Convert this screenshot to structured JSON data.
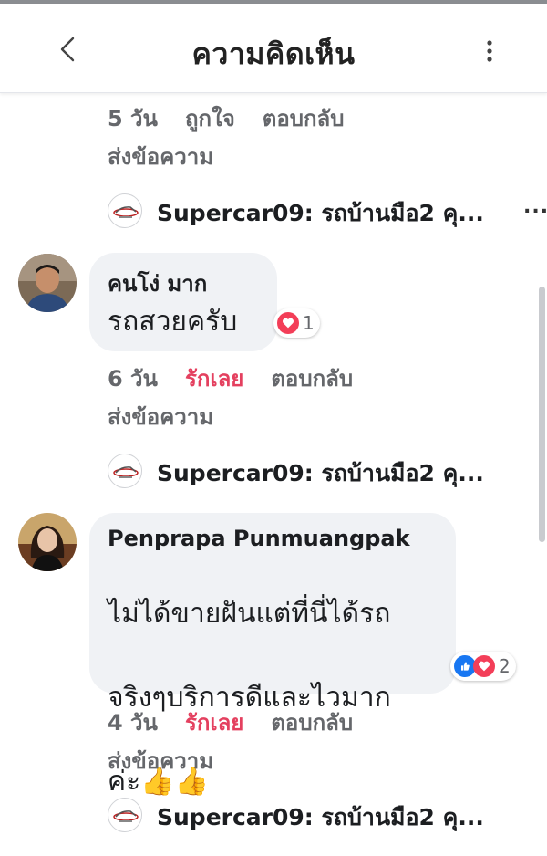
{
  "header": {
    "title": "ความคิดเห็น",
    "back_icon": "chevron-left-icon",
    "more_icon": "kebab-menu-icon"
  },
  "colors": {
    "love": "#e4405f",
    "meta_gray": "#65676b",
    "bubble_bg": "#f0f2f5",
    "like_blue": "#1877f2",
    "love_red": "#f33e58"
  },
  "threads": [
    {
      "actions": {
        "time": "5 วัน",
        "react": "ถูกใจ",
        "reply": "ตอบกลับ"
      },
      "send_message": "ส่งข้อความ",
      "reply_preview": {
        "text": "Supercar09: รถบ้านมือ2 คุ...",
        "more": "..."
      }
    },
    {
      "author": "คนโง่ มาก",
      "text": "รถสวยครับ",
      "reaction_count": "1",
      "actions": {
        "time": "6 วัน",
        "react": "รักเลย",
        "reply": "ตอบกลับ"
      },
      "send_message": "ส่งข้อความ",
      "reply_preview": {
        "text": "Supercar09: รถบ้านมือ2 คุ..."
      }
    },
    {
      "author": "Penprapa Punmuangpak",
      "text_lines": [
        "ไม่ได้ขายฝันแต่ที่นี่ได้รถ",
        "จริงๆบริการดีและไวมาก",
        "ค่ะ"
      ],
      "thumbs": "👍👍",
      "reaction_count": "2",
      "actions": {
        "time": "4 วัน",
        "react": "รักเลย",
        "reply": "ตอบกลับ"
      },
      "send_message": "ส่งข้อความ",
      "reply_preview": {
        "text": "Supercar09: รถบ้านมือ2 คุ..."
      }
    }
  ]
}
